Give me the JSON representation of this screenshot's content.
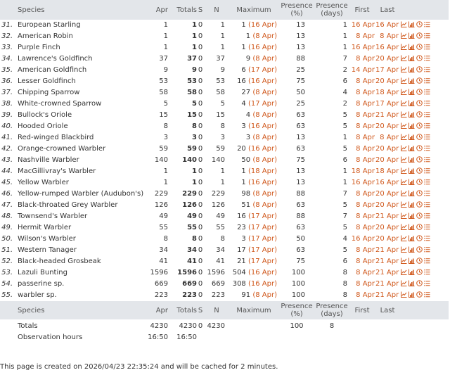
{
  "header": {
    "species": "Species",
    "apr": "Apr",
    "totals": "Totals",
    "s": "S",
    "n": "N",
    "maximum": "Maximum",
    "presence_pct_1": "Presence",
    "presence_pct_2": "(%)",
    "presence_days_1": "Presence",
    "presence_days_2": "(days)",
    "first": "First",
    "last": "Last"
  },
  "rows": [
    {
      "idx": "31.",
      "species": "European Starling",
      "apr": "1",
      "totals": "1",
      "s": "0",
      "n": "1",
      "max": "1",
      "max_date": "(16 Apr)",
      "pct": "13",
      "days": "1",
      "first": "16 Apr",
      "last": "16 Apr"
    },
    {
      "idx": "32.",
      "species": "American Robin",
      "apr": "1",
      "totals": "1",
      "s": "0",
      "n": "1",
      "max": "1",
      "max_date": "(8 Apr)",
      "pct": "13",
      "days": "1",
      "first": "8 Apr",
      "last": "8 Apr"
    },
    {
      "idx": "33.",
      "species": "Purple Finch",
      "apr": "1",
      "totals": "1",
      "s": "0",
      "n": "1",
      "max": "1",
      "max_date": "(16 Apr)",
      "pct": "13",
      "days": "1",
      "first": "16 Apr",
      "last": "16 Apr"
    },
    {
      "idx": "34.",
      "species": "Lawrence's Goldfinch",
      "apr": "37",
      "totals": "37",
      "s": "0",
      "n": "37",
      "max": "9",
      "max_date": "(8 Apr)",
      "pct": "88",
      "days": "7",
      "first": "8 Apr",
      "last": "20 Apr"
    },
    {
      "idx": "35.",
      "species": "American Goldfinch",
      "apr": "9",
      "totals": "9",
      "s": "0",
      "n": "9",
      "max": "6",
      "max_date": "(17 Apr)",
      "pct": "25",
      "days": "2",
      "first": "14 Apr",
      "last": "17 Apr"
    },
    {
      "idx": "36.",
      "species": "Lesser Goldfinch",
      "apr": "53",
      "totals": "53",
      "s": "0",
      "n": "53",
      "max": "16",
      "max_date": "(16 Apr)",
      "pct": "75",
      "days": "6",
      "first": "8 Apr",
      "last": "20 Apr"
    },
    {
      "idx": "37.",
      "species": "Chipping Sparrow",
      "apr": "58",
      "totals": "58",
      "s": "0",
      "n": "58",
      "max": "27",
      "max_date": "(8 Apr)",
      "pct": "50",
      "days": "4",
      "first": "8 Apr",
      "last": "18 Apr"
    },
    {
      "idx": "38.",
      "species": "White-crowned Sparrow",
      "apr": "5",
      "totals": "5",
      "s": "0",
      "n": "5",
      "max": "4",
      "max_date": "(17 Apr)",
      "pct": "25",
      "days": "2",
      "first": "8 Apr",
      "last": "17 Apr"
    },
    {
      "idx": "39.",
      "species": "Bullock's Oriole",
      "apr": "15",
      "totals": "15",
      "s": "0",
      "n": "15",
      "max": "4",
      "max_date": "(8 Apr)",
      "pct": "63",
      "days": "5",
      "first": "8 Apr",
      "last": "21 Apr"
    },
    {
      "idx": "40.",
      "species": "Hooded Oriole",
      "apr": "8",
      "totals": "8",
      "s": "0",
      "n": "8",
      "max": "3",
      "max_date": "(16 Apr)",
      "pct": "63",
      "days": "5",
      "first": "8 Apr",
      "last": "20 Apr"
    },
    {
      "idx": "41.",
      "species": "Red-winged Blackbird",
      "apr": "3",
      "totals": "3",
      "s": "0",
      "n": "3",
      "max": "3",
      "max_date": "(8 Apr)",
      "pct": "13",
      "days": "1",
      "first": "8 Apr",
      "last": "8 Apr"
    },
    {
      "idx": "42.",
      "species": "Orange-crowned Warbler",
      "apr": "59",
      "totals": "59",
      "s": "0",
      "n": "59",
      "max": "20",
      "max_date": "(16 Apr)",
      "pct": "63",
      "days": "5",
      "first": "8 Apr",
      "last": "20 Apr"
    },
    {
      "idx": "43.",
      "species": "Nashville Warbler",
      "apr": "140",
      "totals": "140",
      "s": "0",
      "n": "140",
      "max": "50",
      "max_date": "(8 Apr)",
      "pct": "75",
      "days": "6",
      "first": "8 Apr",
      "last": "20 Apr"
    },
    {
      "idx": "44.",
      "species": "MacGillivray's Warbler",
      "apr": "1",
      "totals": "1",
      "s": "0",
      "n": "1",
      "max": "1",
      "max_date": "(18 Apr)",
      "pct": "13",
      "days": "1",
      "first": "18 Apr",
      "last": "18 Apr"
    },
    {
      "idx": "45.",
      "species": "Yellow Warbler",
      "apr": "1",
      "totals": "1",
      "s": "0",
      "n": "1",
      "max": "1",
      "max_date": "(16 Apr)",
      "pct": "13",
      "days": "1",
      "first": "16 Apr",
      "last": "16 Apr"
    },
    {
      "idx": "46.",
      "species": "Yellow-rumped Warbler (Audubon's)",
      "apr": "229",
      "totals": "229",
      "s": "0",
      "n": "229",
      "max": "98",
      "max_date": "(8 Apr)",
      "pct": "88",
      "days": "7",
      "first": "8 Apr",
      "last": "20 Apr"
    },
    {
      "idx": "47.",
      "species": "Black-throated Grey Warbler",
      "apr": "126",
      "totals": "126",
      "s": "0",
      "n": "126",
      "max": "51",
      "max_date": "(8 Apr)",
      "pct": "63",
      "days": "5",
      "first": "8 Apr",
      "last": "20 Apr"
    },
    {
      "idx": "48.",
      "species": "Townsend's Warbler",
      "apr": "49",
      "totals": "49",
      "s": "0",
      "n": "49",
      "max": "16",
      "max_date": "(17 Apr)",
      "pct": "88",
      "days": "7",
      "first": "8 Apr",
      "last": "21 Apr"
    },
    {
      "idx": "49.",
      "species": "Hermit Warbler",
      "apr": "55",
      "totals": "55",
      "s": "0",
      "n": "55",
      "max": "23",
      "max_date": "(17 Apr)",
      "pct": "63",
      "days": "5",
      "first": "8 Apr",
      "last": "20 Apr"
    },
    {
      "idx": "50.",
      "species": "Wilson's Warbler",
      "apr": "8",
      "totals": "8",
      "s": "0",
      "n": "8",
      "max": "3",
      "max_date": "(17 Apr)",
      "pct": "50",
      "days": "4",
      "first": "16 Apr",
      "last": "20 Apr"
    },
    {
      "idx": "51.",
      "species": "Western Tanager",
      "apr": "34",
      "totals": "34",
      "s": "0",
      "n": "34",
      "max": "17",
      "max_date": "(17 Apr)",
      "pct": "63",
      "days": "5",
      "first": "8 Apr",
      "last": "21 Apr"
    },
    {
      "idx": "52.",
      "species": "Black-headed Grosbeak",
      "apr": "41",
      "totals": "41",
      "s": "0",
      "n": "41",
      "max": "21",
      "max_date": "(17 Apr)",
      "pct": "75",
      "days": "6",
      "first": "8 Apr",
      "last": "21 Apr"
    },
    {
      "idx": "53.",
      "species": "Lazuli Bunting",
      "apr": "1596",
      "totals": "1596",
      "s": "0",
      "n": "1596",
      "max": "504",
      "max_date": "(16 Apr)",
      "pct": "100",
      "days": "8",
      "first": "8 Apr",
      "last": "21 Apr"
    },
    {
      "idx": "54.",
      "species": "passerine sp.",
      "apr": "669",
      "totals": "669",
      "s": "0",
      "n": "669",
      "max": "308",
      "max_date": "(16 Apr)",
      "pct": "100",
      "days": "8",
      "first": "8 Apr",
      "last": "21 Apr"
    },
    {
      "idx": "55.",
      "species": "warbler sp.",
      "apr": "223",
      "totals": "223",
      "s": "0",
      "n": "223",
      "max": "91",
      "max_date": "(8 Apr)",
      "pct": "100",
      "days": "8",
      "first": "8 Apr",
      "last": "21 Apr"
    }
  ],
  "totals": {
    "label": "Totals",
    "apr": "4230",
    "totals": "4230",
    "s": "0",
    "n": "4230",
    "pct": "100",
    "days": "8"
  },
  "hours": {
    "label": "Observation hours",
    "apr": "16:50",
    "totals": "16:50"
  },
  "row_icons": [
    "line-chart-icon",
    "bar-chart-icon",
    "clock-icon",
    "list-icon"
  ],
  "colors": {
    "accent": "#d0581c",
    "header_bg": "#e3e6ea"
  },
  "footer_note": "This page is created on 2026/04/23 22:35:24 and will be cached for 2 minutes."
}
